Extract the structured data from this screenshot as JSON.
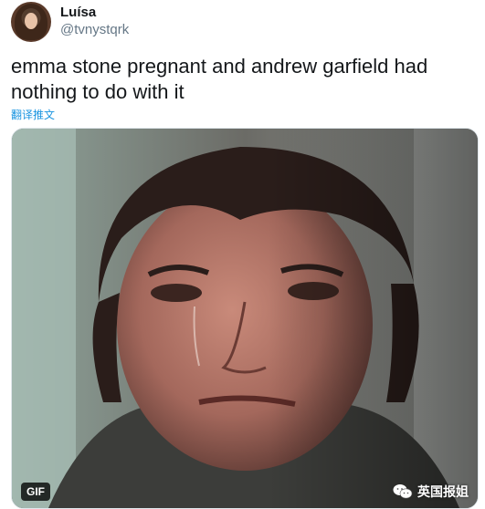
{
  "author": {
    "name": "Luísa",
    "handle": "@tvnystqrk"
  },
  "tweet": {
    "text": "emma stone pregnant and andrew garfield had nothing to do with it",
    "translate_label": "翻译推文"
  },
  "media": {
    "badge": "GIF",
    "watermark": "英国报姐"
  },
  "colors": {
    "text": "#14171a",
    "secondary": "#657786",
    "link": "#1b95e0"
  }
}
